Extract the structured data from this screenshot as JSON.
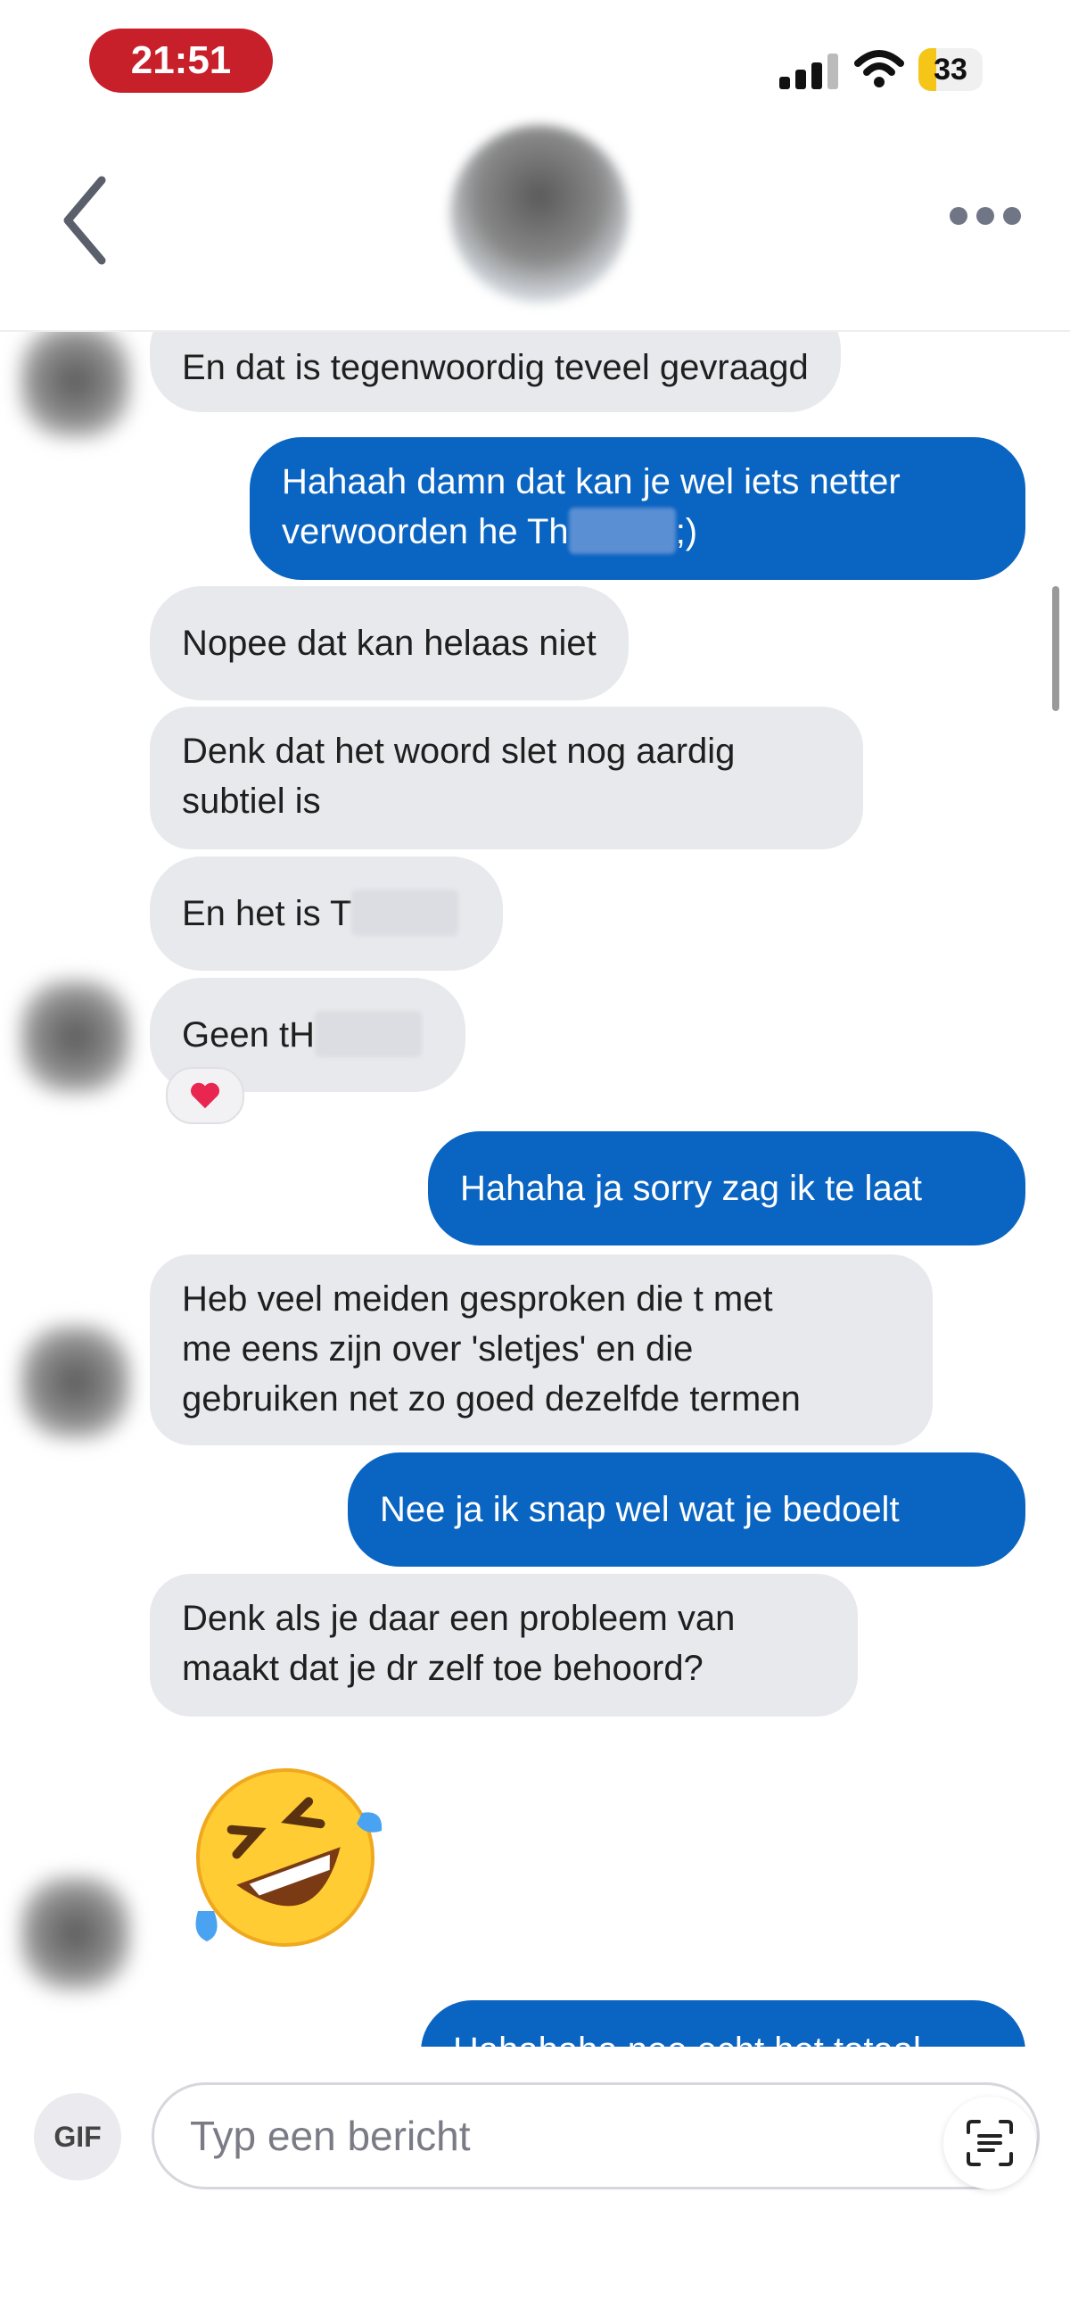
{
  "status_bar": {
    "time": "21:51",
    "battery": "33"
  },
  "header": {
    "back_icon": "chevron-left-icon",
    "more_icon": "more-dots-icon"
  },
  "messages": [
    {
      "dir": "in",
      "text": "En dat is tegenwoordig teveel gevraagd"
    },
    {
      "dir": "out",
      "line1": "Hahaah damn dat kan je wel iets netter",
      "line2_prefix": "verwoorden he Th",
      "line2_suffix": ";)"
    },
    {
      "dir": "in",
      "text": "Nopee dat kan helaas niet"
    },
    {
      "dir": "in",
      "line1": "Denk dat het woord slet nog aardig",
      "line2": "subtiel is"
    },
    {
      "dir": "in",
      "prefix": "En het is T"
    },
    {
      "dir": "in",
      "prefix": "Geen tH",
      "reaction": "heart-icon"
    },
    {
      "dir": "out",
      "text": "Hahaha ja sorry zag ik te laat"
    },
    {
      "dir": "in",
      "line1": "Heb veel meiden gesproken die t met",
      "line2": "me eens zijn over 'sletjes' en die",
      "line3": "gebruiken net zo goed dezelfde termen"
    },
    {
      "dir": "out",
      "text": "Nee ja ik snap wel wat je bedoelt"
    },
    {
      "dir": "in",
      "line1": "Denk als je daar een probleem van",
      "line2": "maakt dat je dr zelf toe behoord?"
    },
    {
      "dir": "in",
      "emoji": "rolling-on-floor-laughing-emoji"
    },
    {
      "dir": "out",
      "text": "Hahahaha nee echt het totaal"
    }
  ],
  "composer": {
    "gif_label": "GIF",
    "placeholder": "Typ een bericht",
    "scan_icon": "text-scan-icon"
  },
  "colors": {
    "outgoing": "#0a64c2",
    "incoming": "#e8e9ed",
    "time_pill": "#c8202a",
    "reaction_heart": "#e8264f"
  }
}
